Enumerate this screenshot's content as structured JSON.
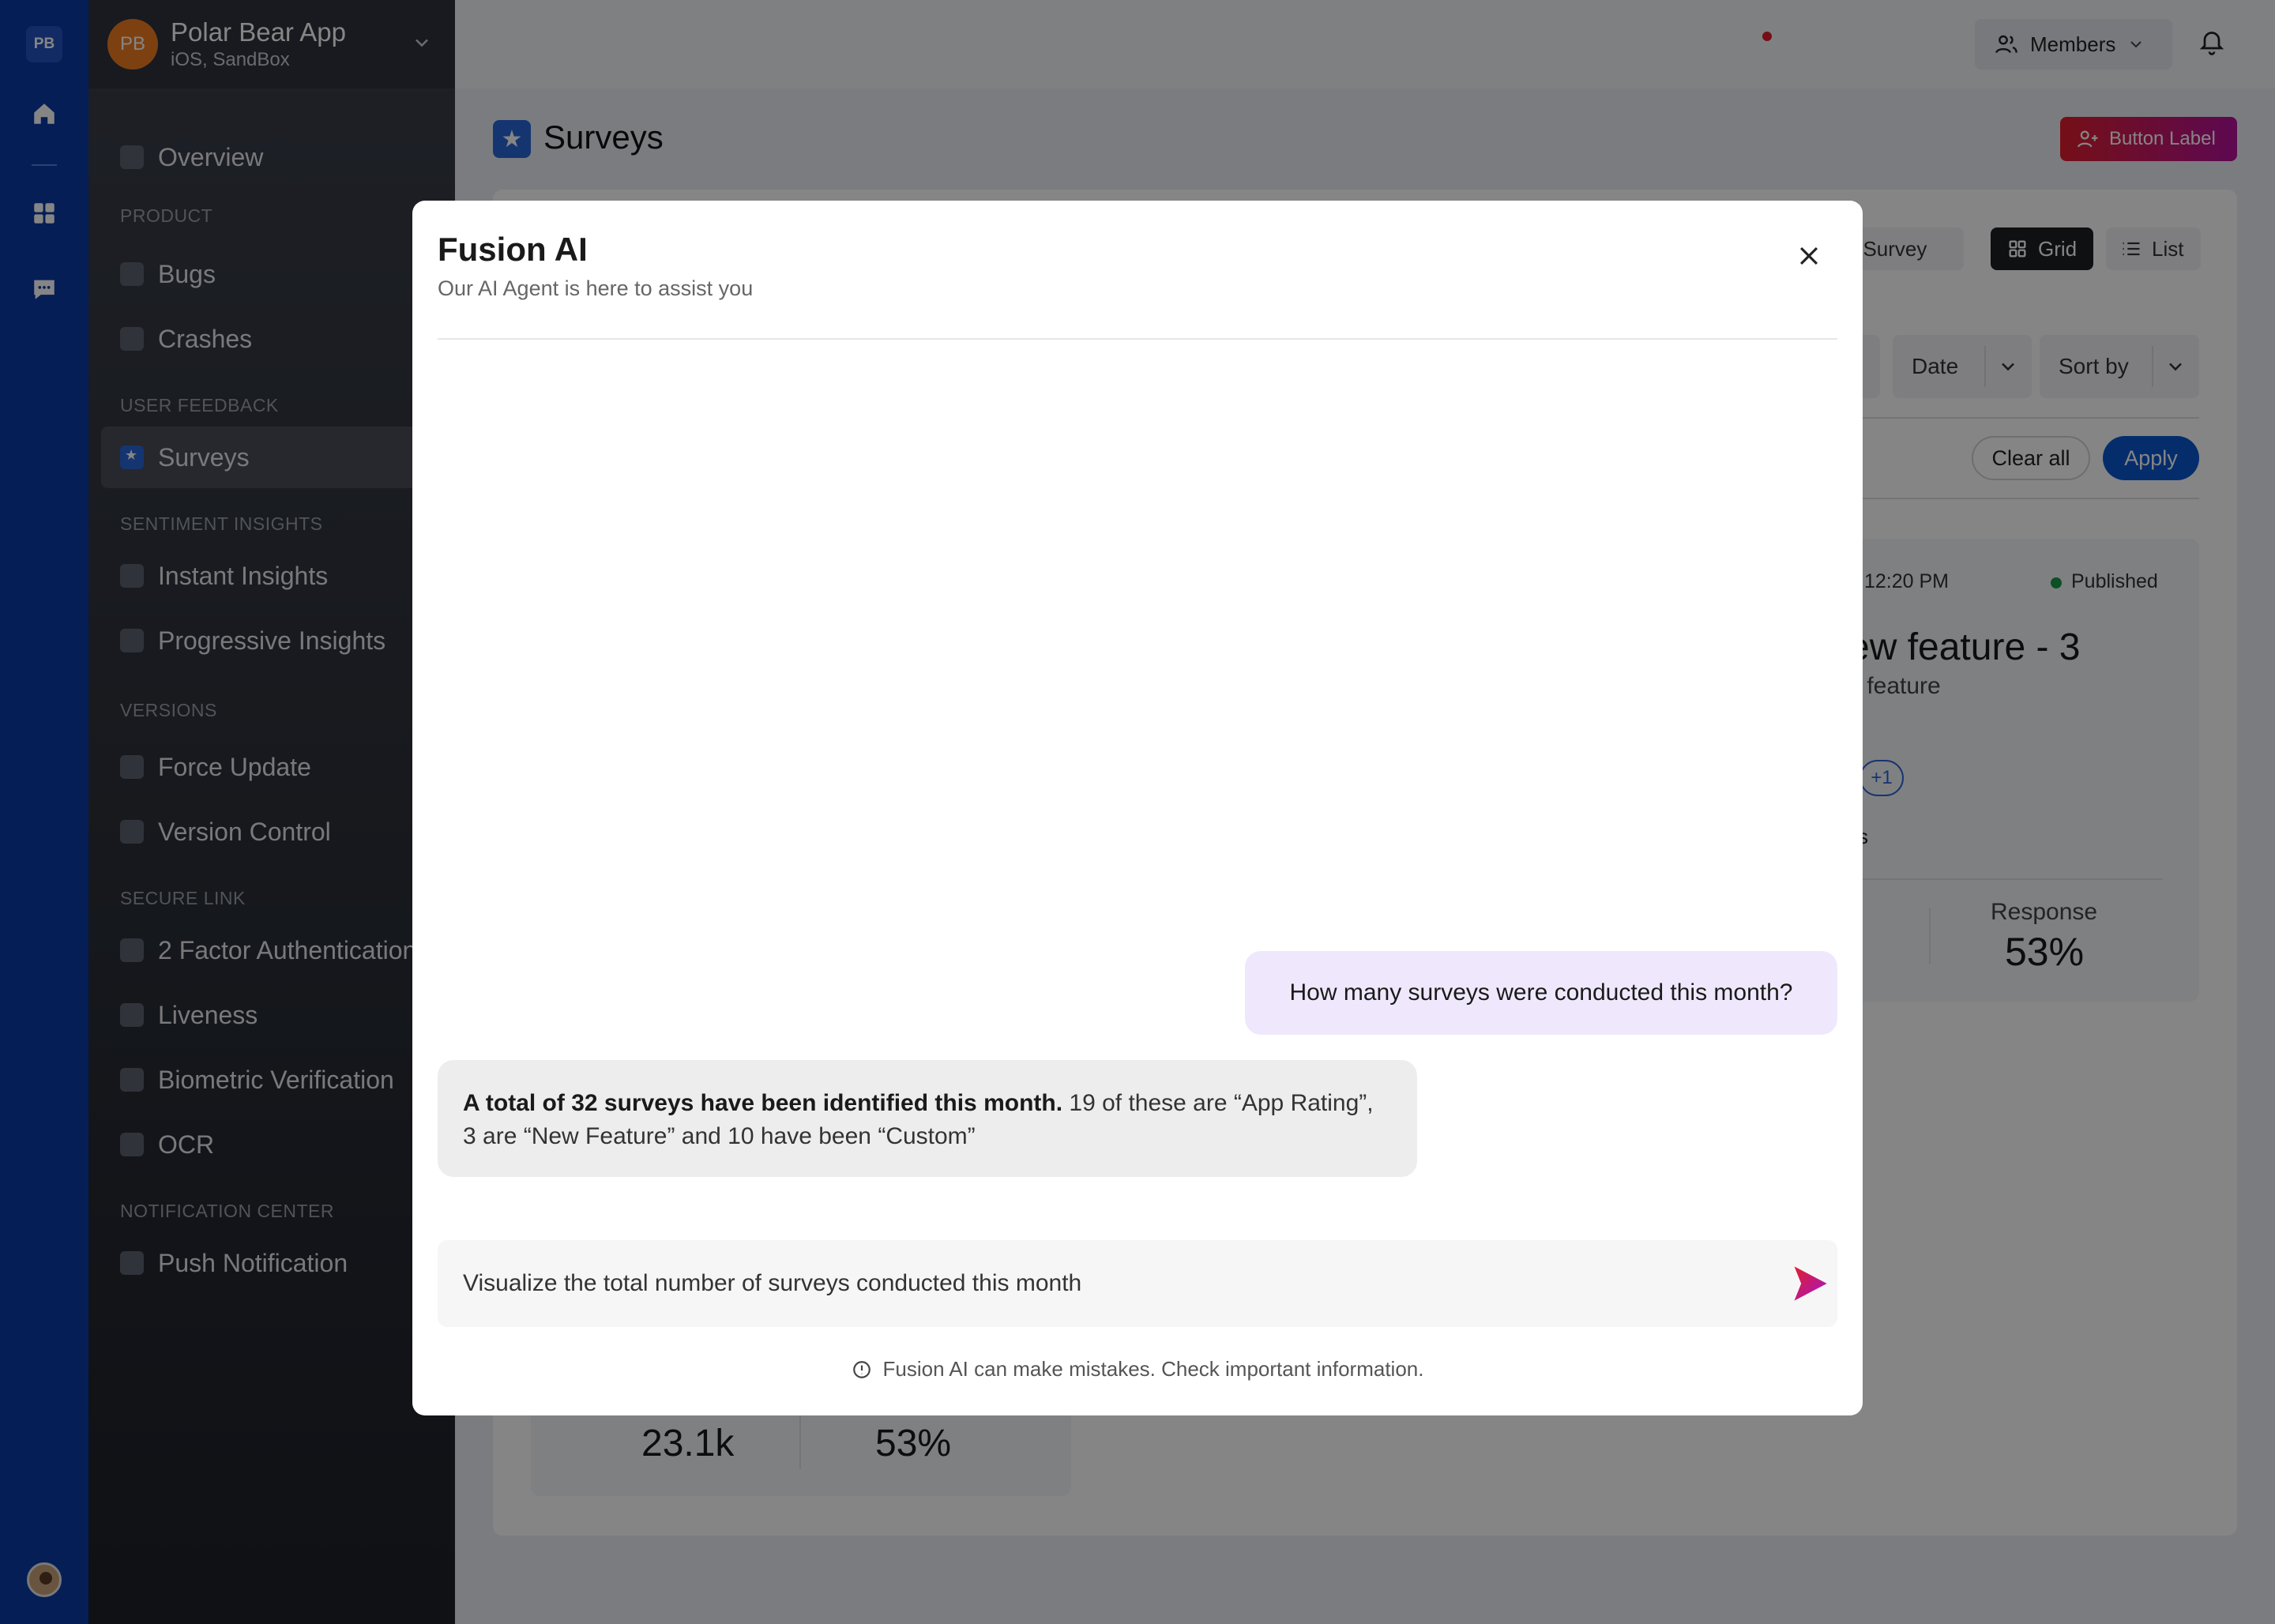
{
  "rail": {
    "logo": "PB"
  },
  "app": {
    "avatar": "PB",
    "name": "Polar Bear App",
    "platform": "iOS, SandBox"
  },
  "sidebar": {
    "overview": "Overview",
    "sections": {
      "product": "PRODUCT",
      "user_feedback": "USER FEEDBACK",
      "sentiment": "SENTIMENT INSIGHTS",
      "versions": "VERSIONS",
      "secure_link": "SECURE LINK",
      "notification": "NOTIFICATION CENTER"
    },
    "items": {
      "bugs": "Bugs",
      "crashes": "Crashes",
      "surveys": "Surveys",
      "instant_insights": "Instant Insights",
      "progressive_insights": "Progressive Insights",
      "force_update": "Force Update",
      "version_control": "Version Control",
      "two_factor": "2 Factor Authentication",
      "liveness": "Liveness",
      "biometric": "Biometric Verification",
      "ocr": "OCR",
      "push": "Push Notification"
    }
  },
  "topbar": {
    "members": "Members"
  },
  "page": {
    "title": "Surveys",
    "primary_button": "Button Label",
    "new_survey": "ew Survey",
    "view_grid": "Grid",
    "view_list": "List",
    "filter_date": "Date",
    "sort_by": "Sort by",
    "clear_all": "Clear all",
    "apply": "Apply"
  },
  "survey_card": {
    "time": "12:20 PM",
    "status": "Published",
    "title": "ew feature - 3",
    "subtitle": "v feature",
    "badge": "+1",
    "meta": "s",
    "response_label": "Response",
    "response_value": "53%"
  },
  "survey_card_2": {
    "metric1_value": "23.1k",
    "metric2_value": "53%"
  },
  "colors": {
    "brand": "#0b3ba6",
    "accent": "#2a66d9",
    "primary_gradient_start": "#e01e2d",
    "primary_gradient_end": "#b3129c",
    "published": "#1a9a4a"
  },
  "modal": {
    "title": "Fusion AI",
    "subtitle": "Our AI Agent is here to assist you",
    "user_message": "How many surveys were conducted this month?",
    "ai_message_bold": "A total of 32 surveys have been identified this month.",
    "ai_message_rest": " 19 of these are “App Rating”, 3 are “New Feature” and 10 have been “Custom”",
    "composer_value": "Visualize the total number of surveys conducted this month",
    "disclaimer": "Fusion AI can make mistakes. Check important information."
  }
}
